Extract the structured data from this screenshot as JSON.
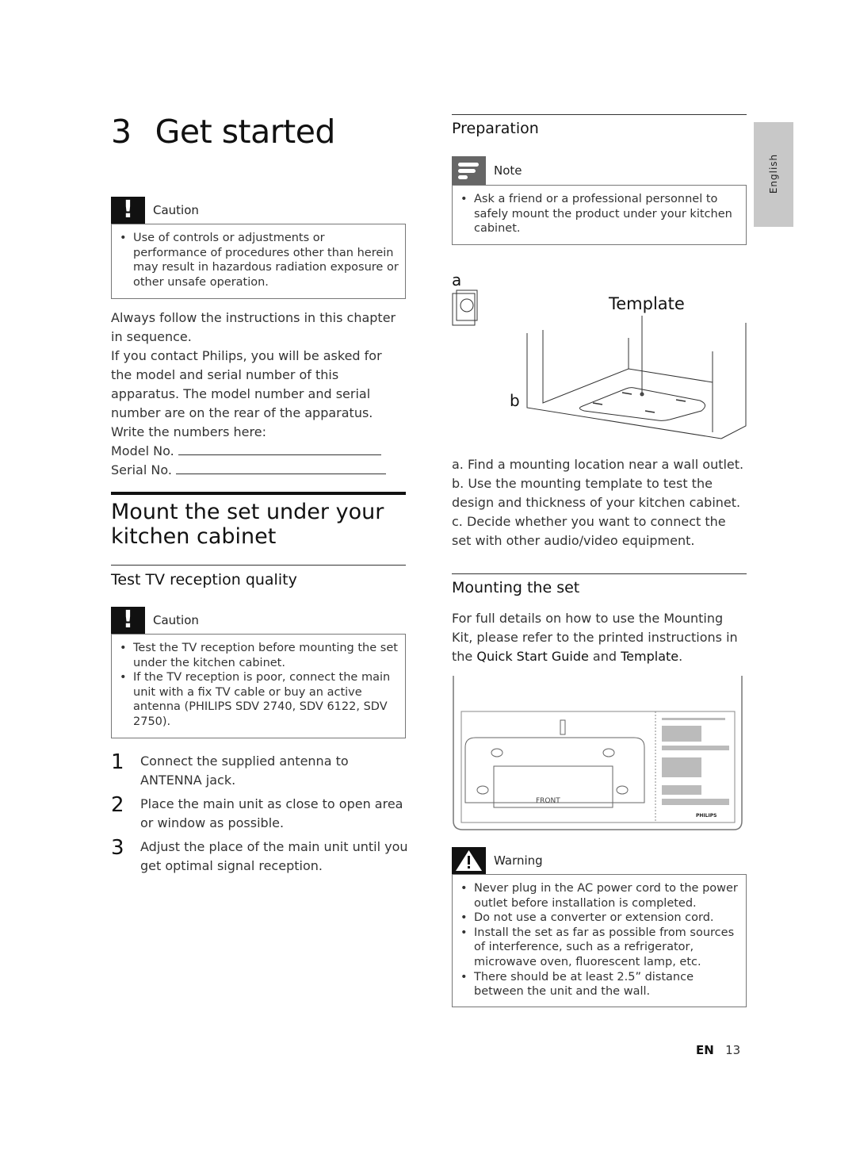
{
  "chapter": {
    "number": "3",
    "title": "Get started"
  },
  "side_tab": "English",
  "caution1": {
    "label": "Caution",
    "items": [
      "Use of controls or adjustments or performance of procedures other than herein may result in hazardous radiation exposure or other unsafe operation."
    ]
  },
  "intro": {
    "p1": "Always follow the instructions in this chapter in sequence.",
    "p2": "If you contact Philips, you will be asked for the model and serial number of this apparatus. The model number and serial number are on the rear of the apparatus. Write the numbers here:",
    "model_label": "Model No.",
    "serial_label": "Serial No."
  },
  "mount_title": "Mount the set under your kitchen cabinet",
  "test_title": "Test TV reception quality",
  "caution2": {
    "label": "Caution",
    "items": [
      "Test the TV reception before mounting the set under the kitchen cabinet.",
      "If the TV reception is poor, connect the main unit with a fix TV cable or buy an active antenna (PHILIPS SDV 2740, SDV 6122, SDV 2750)."
    ]
  },
  "steps": [
    {
      "num": "1",
      "text": "Connect the supplied antenna to ANTENNA jack."
    },
    {
      "num": "2",
      "text": "Place the main unit as close to open area or window as possible."
    },
    {
      "num": "3",
      "text": "Adjust the place of the main unit until you get optimal signal reception."
    }
  ],
  "preparation": {
    "title": "Preparation",
    "note_label": "Note",
    "note_items": [
      "Ask a friend or a professional personnel to safely mount the product under your kitchen cabinet."
    ]
  },
  "figure1": {
    "label_a": "a",
    "label_b": "b",
    "template_label": "Template"
  },
  "figure_steps": [
    "a. Find a mounting location near a wall outlet.",
    "b. Use the mounting template to test the design and thickness of your kitchen cabinet.",
    "c. Decide whether you want to connect the set with other audio/video equipment."
  ],
  "mounting": {
    "title": "Mounting the set",
    "text_pre": "For full details on how to use the Mounting Kit, please refer to the printed instructions in the ",
    "guide": "Quick Start Guide",
    "text_mid": " and ",
    "template": "Template",
    "text_end": "."
  },
  "figure2": {
    "front_label": "FRONT",
    "brand": "PHILIPS"
  },
  "warning": {
    "label": "Warning",
    "items": [
      "Never plug in the AC power cord to the power outlet before installation is completed.",
      "Do not use a converter or extension cord.",
      "Install the set as far as possible from sources of interference, such as a refrigerator, microwave oven, fluorescent lamp, etc.",
      "There should be at least 2.5” distance between the unit and the wall."
    ]
  },
  "footer": {
    "lang": "EN",
    "page": "13"
  }
}
